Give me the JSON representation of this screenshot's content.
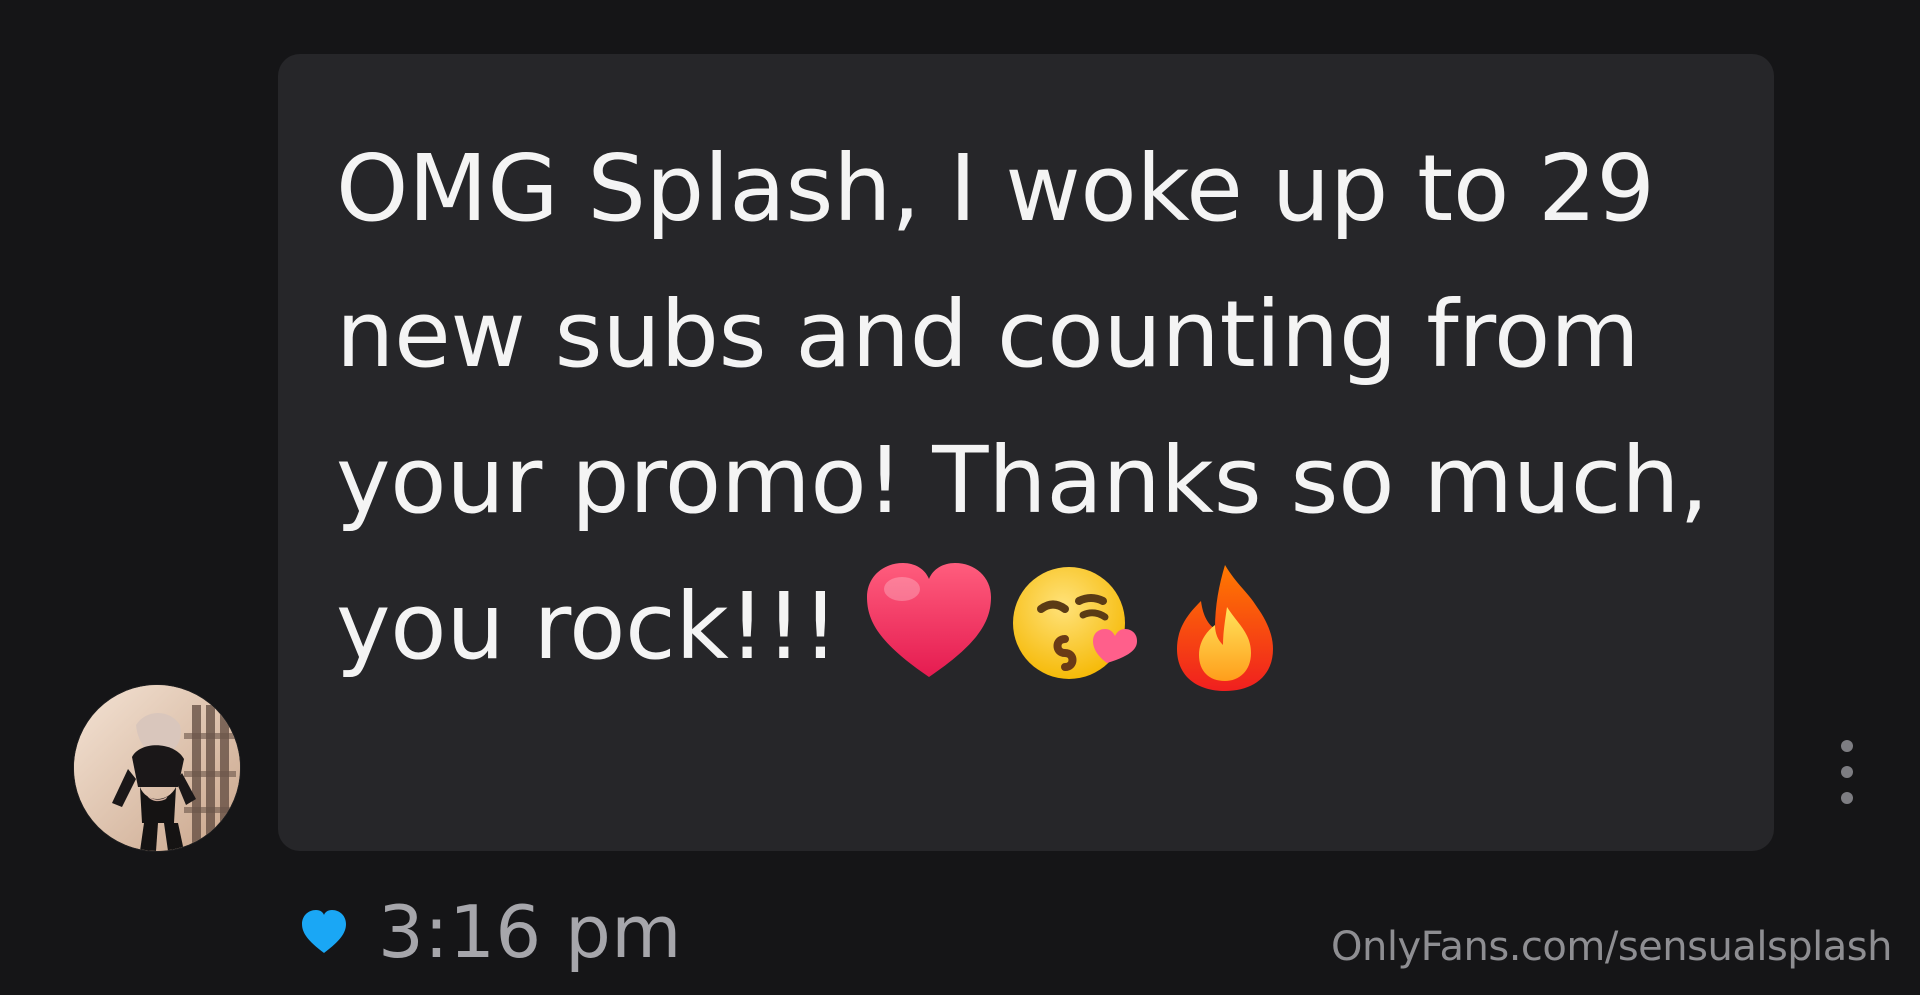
{
  "message": {
    "text": "OMG Splash, I woke up to 29 new subs and counting from your promo! Thanks so much, you rock!!!",
    "emojis": [
      "heart-emoji",
      "face-blowing-kiss-emoji",
      "fire-emoji"
    ],
    "timestamp": "3:16 pm"
  },
  "watermark": {
    "text": "OnlyFans.com/sensualsplash"
  },
  "icons": {
    "like": "heart-icon",
    "more": "more-vertical-icon",
    "avatar": "user-avatar"
  },
  "colors": {
    "background": "#151517",
    "bubble": "#262629",
    "text": "#f4f4f4",
    "meta": "#a6a6ab",
    "heart_blue": "#1aa7f5"
  }
}
